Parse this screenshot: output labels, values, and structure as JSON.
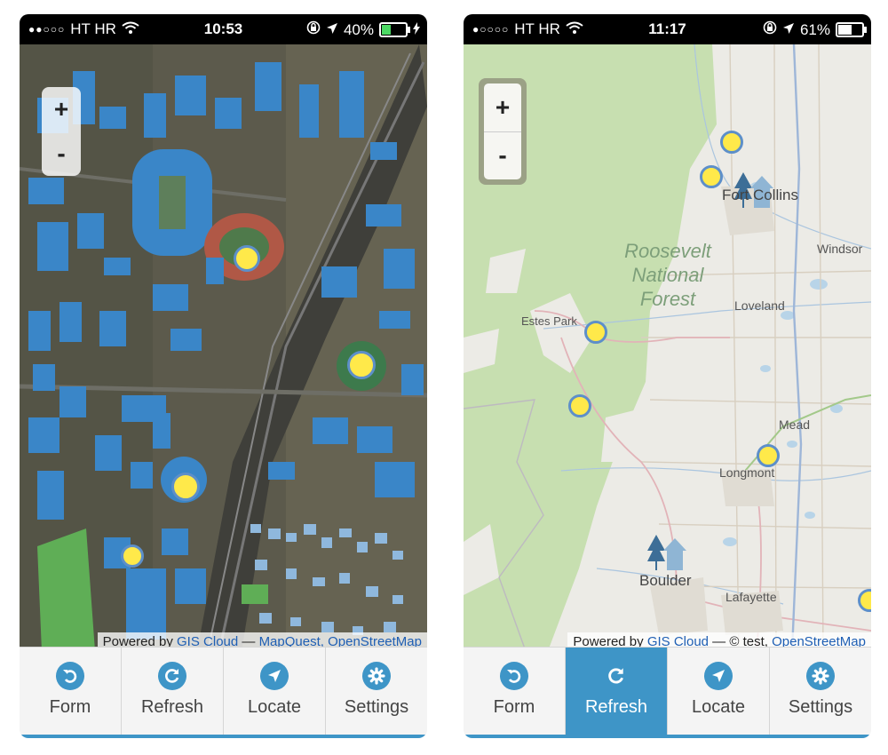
{
  "left_phone": {
    "status": {
      "carrier_dots": "●●○○○",
      "carrier": "HT HR",
      "time": "10:53",
      "battery": "40%",
      "battery_fraction": 0.4,
      "charging": true
    },
    "zoom": {
      "in_label": "+",
      "out_label": "-"
    },
    "attribution": {
      "prefix": "Powered by ",
      "gis_link": "GIS Cloud",
      "sep": " — ",
      "sources": "MapQuest, OpenStreetMap"
    },
    "tabs": [
      {
        "label": "Form",
        "icon": "undo-icon"
      },
      {
        "label": "Refresh",
        "icon": "refresh-icon"
      },
      {
        "label": "Locate",
        "icon": "location-arrow-icon"
      },
      {
        "label": "Settings",
        "icon": "gear-icon"
      }
    ],
    "markers": 5
  },
  "right_phone": {
    "status": {
      "carrier_dots": "●○○○○",
      "carrier": "HT HR",
      "time": "11:17",
      "battery": "61%",
      "battery_fraction": 0.61,
      "charging": false
    },
    "zoom": {
      "in_label": "+",
      "out_label": "-"
    },
    "map_labels": {
      "fort_collins": "Fort Collins",
      "windsor": "Windsor",
      "loveland": "Loveland",
      "estes_park": "Estes Park",
      "mead": "Mead",
      "longmont": "Longmont",
      "boulder": "Boulder",
      "lafayette": "Lafayette",
      "forest_line1": "Roosevelt",
      "forest_line2": "National",
      "forest_line3": "Forest"
    },
    "attribution": {
      "prefix": "Powered by ",
      "gis_link": "GIS Cloud",
      "sep": " — © test, ",
      "sources": "OpenStreetMap"
    },
    "tabs": [
      {
        "label": "Form",
        "icon": "undo-icon"
      },
      {
        "label": "Refresh",
        "icon": "refresh-icon",
        "active": true
      },
      {
        "label": "Locate",
        "icon": "location-arrow-icon"
      },
      {
        "label": "Settings",
        "icon": "gear-icon"
      }
    ],
    "markers": 7
  },
  "colors": {
    "accent": "#3e95c7",
    "marker_fill": "#ffe94a",
    "marker_border": "#5d8fc9",
    "building": "#3a86c8",
    "forest": "#c7dfb0"
  }
}
